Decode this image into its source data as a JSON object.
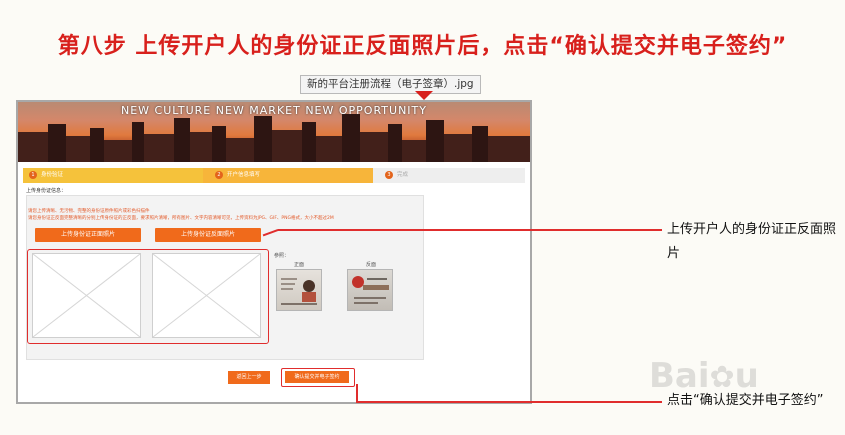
{
  "heading": "第八步 上传开户人的身份证正反面照片后，点击“确认提交并电子签约”",
  "filename_tag": "新的平台注册流程（电子签章）.jpg",
  "banner": {
    "text": "NEW CULTURE NEW MARKET NEW OPPORTUNITY"
  },
  "steps": [
    {
      "num": "1",
      "label": "身份验证"
    },
    {
      "num": "2",
      "label": "开户信息填写"
    },
    {
      "num": "3",
      "label": "完成"
    }
  ],
  "form": {
    "section_title": "上传身份证信息：",
    "instructions": [
      "请您上传清晰、无污物、完整的身份证原件照片或彩色扫描件",
      "请您身份证正反面完整清晰的分别上传身份证的正反面，要求照片清晰，所有图片、文字内容清晰可见，上传资料为JPG、GIF、PNG格式，大小不超过2M"
    ],
    "upload_front_button": "上传身份证正面照片",
    "upload_back_button": "上传身份证反面照片",
    "example_label": "参照：",
    "front_caption": "正面",
    "back_caption": "反面",
    "back_button": "返回上一步",
    "confirm_button": "确认提交并电子签约"
  },
  "callouts": {
    "upload": "上传开户人的身份证正反面照片",
    "confirm": "点击“确认提交并电子签约”"
  },
  "colors": {
    "accent": "#d8201c",
    "orange": "#f06a1b",
    "step": "#f5c23b"
  }
}
